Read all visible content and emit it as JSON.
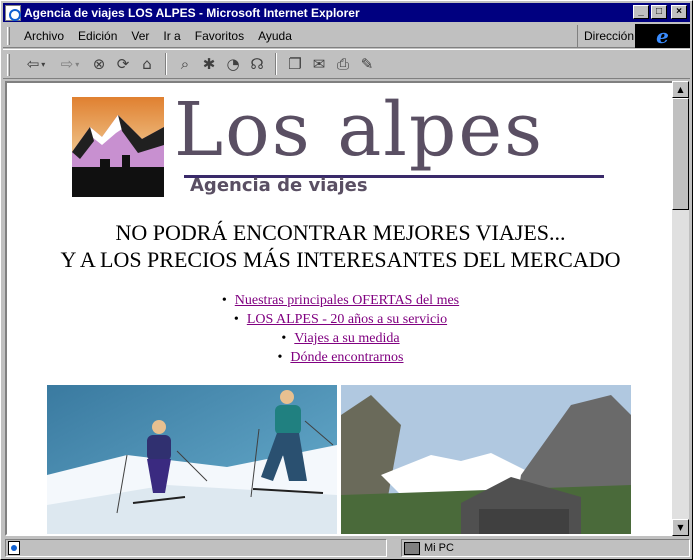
{
  "window": {
    "title": "Agencia de viajes LOS ALPES - Microsoft Internet Explorer",
    "min_label": "_",
    "max_label": "□",
    "close_label": "×"
  },
  "menu": {
    "items": [
      "Archivo",
      "Edición",
      "Ver",
      "Ir a",
      "Favoritos",
      "Ayuda"
    ],
    "address_label": "Dirección",
    "brand_glyph": "e"
  },
  "toolbar": {
    "icons": [
      "back-icon",
      "forward-icon",
      "stop-icon",
      "refresh-icon",
      "home-icon",
      "search-icon",
      "favorites-icon",
      "history-icon",
      "channels-icon",
      "fullscreen-icon",
      "mail-icon",
      "print-icon",
      "edit-icon"
    ]
  },
  "page": {
    "logo_text": "Los alpes",
    "logo_subtitle": "Agencia de viajes",
    "headline_line1": "NO PODRÁ ENCONTRAR MEJORES VIAJES...",
    "headline_line2": "Y A LOS PRECIOS MÁS INTERESANTES DEL MERCADO",
    "links": [
      "Nuestras principales OFERTAS del mes",
      "LOS ALPES - 20 años a su servicio",
      "Viajes a su medida",
      "Dónde encontrarnos"
    ],
    "link_color": "#800080"
  },
  "status": {
    "main_text": "",
    "zone_text": "Mi PC"
  },
  "colors": {
    "titlebar": "#000080",
    "chrome": "#c0c0c0",
    "logo_text": "#5a4f63"
  }
}
